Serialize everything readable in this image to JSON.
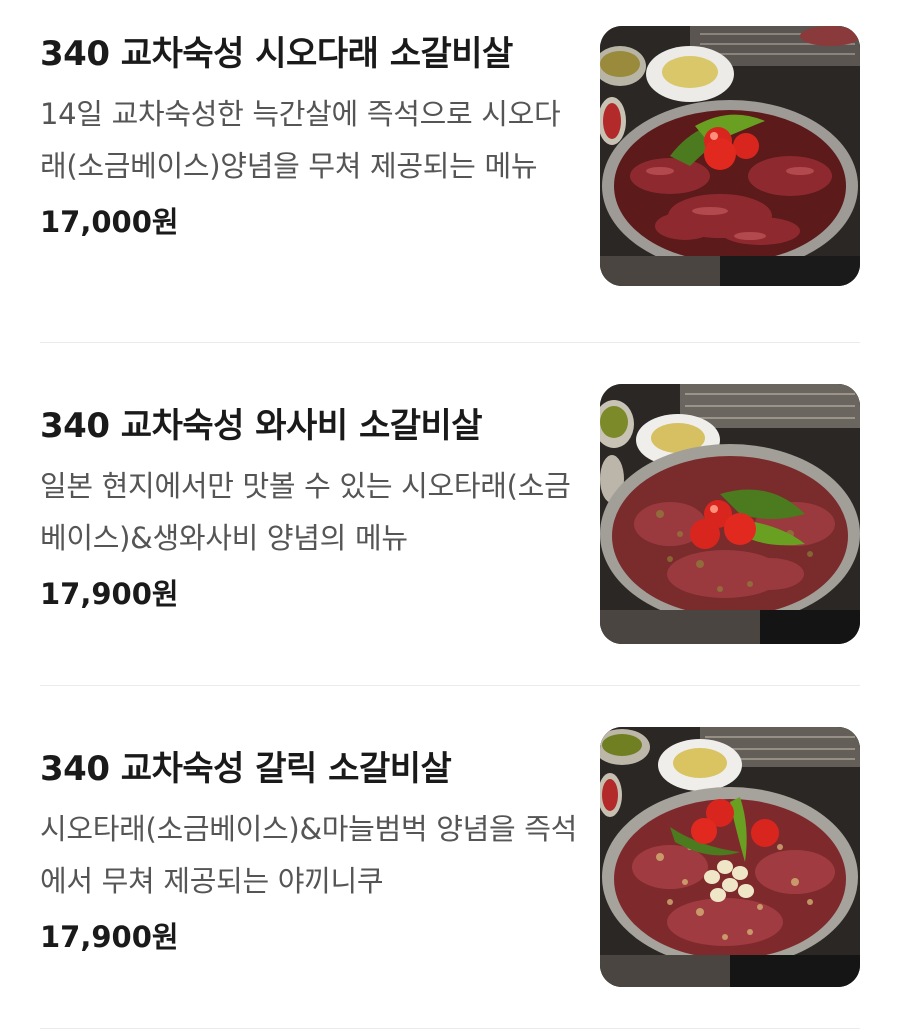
{
  "menu": {
    "items": [
      {
        "name": "340 교차숙성 시오다래 소갈비살",
        "description": "14일 교차숙성한 늑간살에 즉석으로 시오다래(소금베이스)양념을 무쳐 제공되는 메뉴",
        "price": "17,000원",
        "image_icon": "meat-platter-photo"
      },
      {
        "name": "340 교차숙성 와사비 소갈비살",
        "description": "일본 현지에서만 맛볼 수 있는 시오타래(소금베이스)&생와사비 양념의 메뉴",
        "price": "17,900원",
        "image_icon": "meat-platter-photo"
      },
      {
        "name": "340 교차숙성 갈릭 소갈비살",
        "description": "시오타래(소금베이스)&마늘범벅 양념을 즉석에서 무쳐 제공되는 야끼니쿠",
        "price": "17,900원",
        "image_icon": "meat-platter-photo"
      }
    ]
  }
}
